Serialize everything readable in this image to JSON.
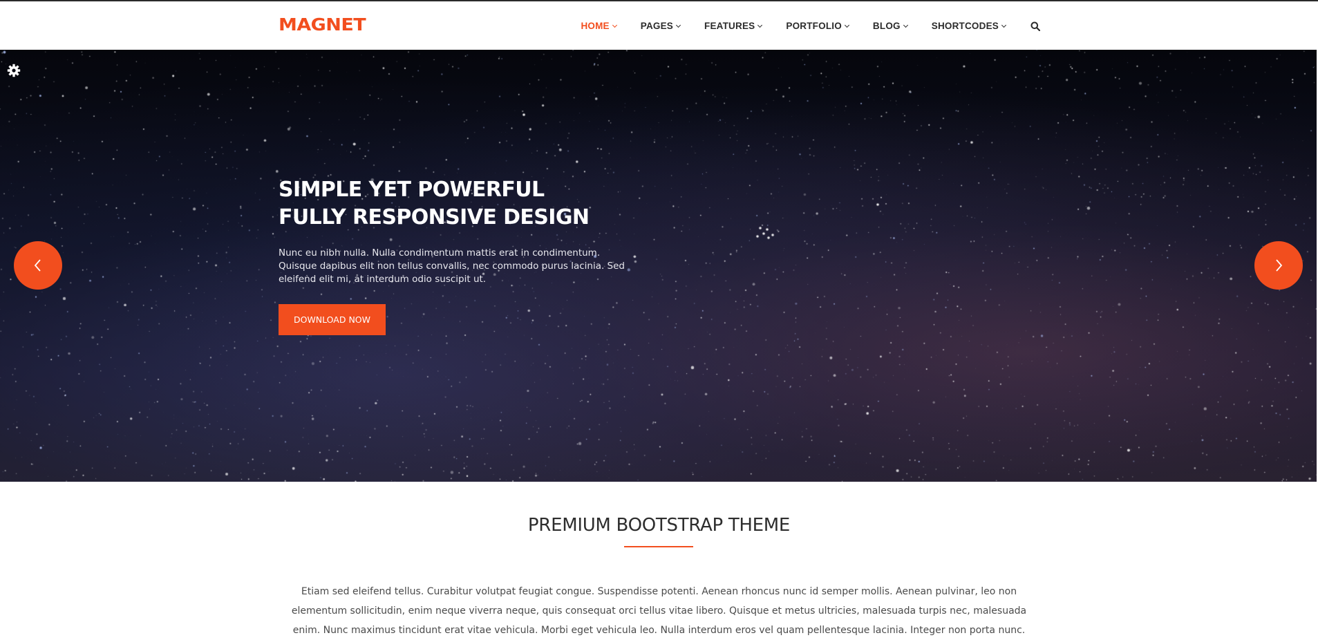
{
  "header": {
    "logo": "MAGNET",
    "nav": [
      {
        "label": "HOME",
        "active": true
      },
      {
        "label": "PAGES",
        "active": false
      },
      {
        "label": "FEATURES",
        "active": false
      },
      {
        "label": "PORTFOLIO",
        "active": false
      },
      {
        "label": "BLOG",
        "active": false
      },
      {
        "label": "SHORTCODES",
        "active": false
      }
    ],
    "search_icon": "search-icon"
  },
  "hero": {
    "settings_icon": "gear-icon",
    "title_line1": "SIMPLE YET POWERFUL",
    "title_line2": "FULLY RESPONSIVE DESIGN",
    "text": "Nunc eu nibh nulla. Nulla condimentum mattis erat in condimentum. Quisque dapibus elit non tellus convallis, nec commodo purus lacinia. Sed eleifend elit mi, at interdum odio suscipit ut.",
    "button_label": "DOWNLOAD NOW",
    "prev_icon": "chevron-left-icon",
    "next_icon": "chevron-right-icon"
  },
  "intro": {
    "title": "PREMIUM BOOTSTRAP THEME",
    "text": "Etiam sed eleifend tellus. Curabitur volutpat feugiat congue. Suspendisse potenti. Aenean rhoncus nunc id semper mollis. Aenean pulvinar, leo non elementum sollicitudin, enim neque viverra neque, quis consequat orci tellus vitae libero. Quisque et metus ultricies, malesuada turpis nec, malesuada enim. Nunc maximus tincidunt erat vitae vehicula. Morbi eget vehicula leo. Nulla interdum eros vel quam pellentesque lacinia. Integer non porta nunc."
  },
  "colors": {
    "accent": "#f24e1e",
    "text_dark": "#2b2b2b",
    "hero_bg": "#0f1224"
  }
}
